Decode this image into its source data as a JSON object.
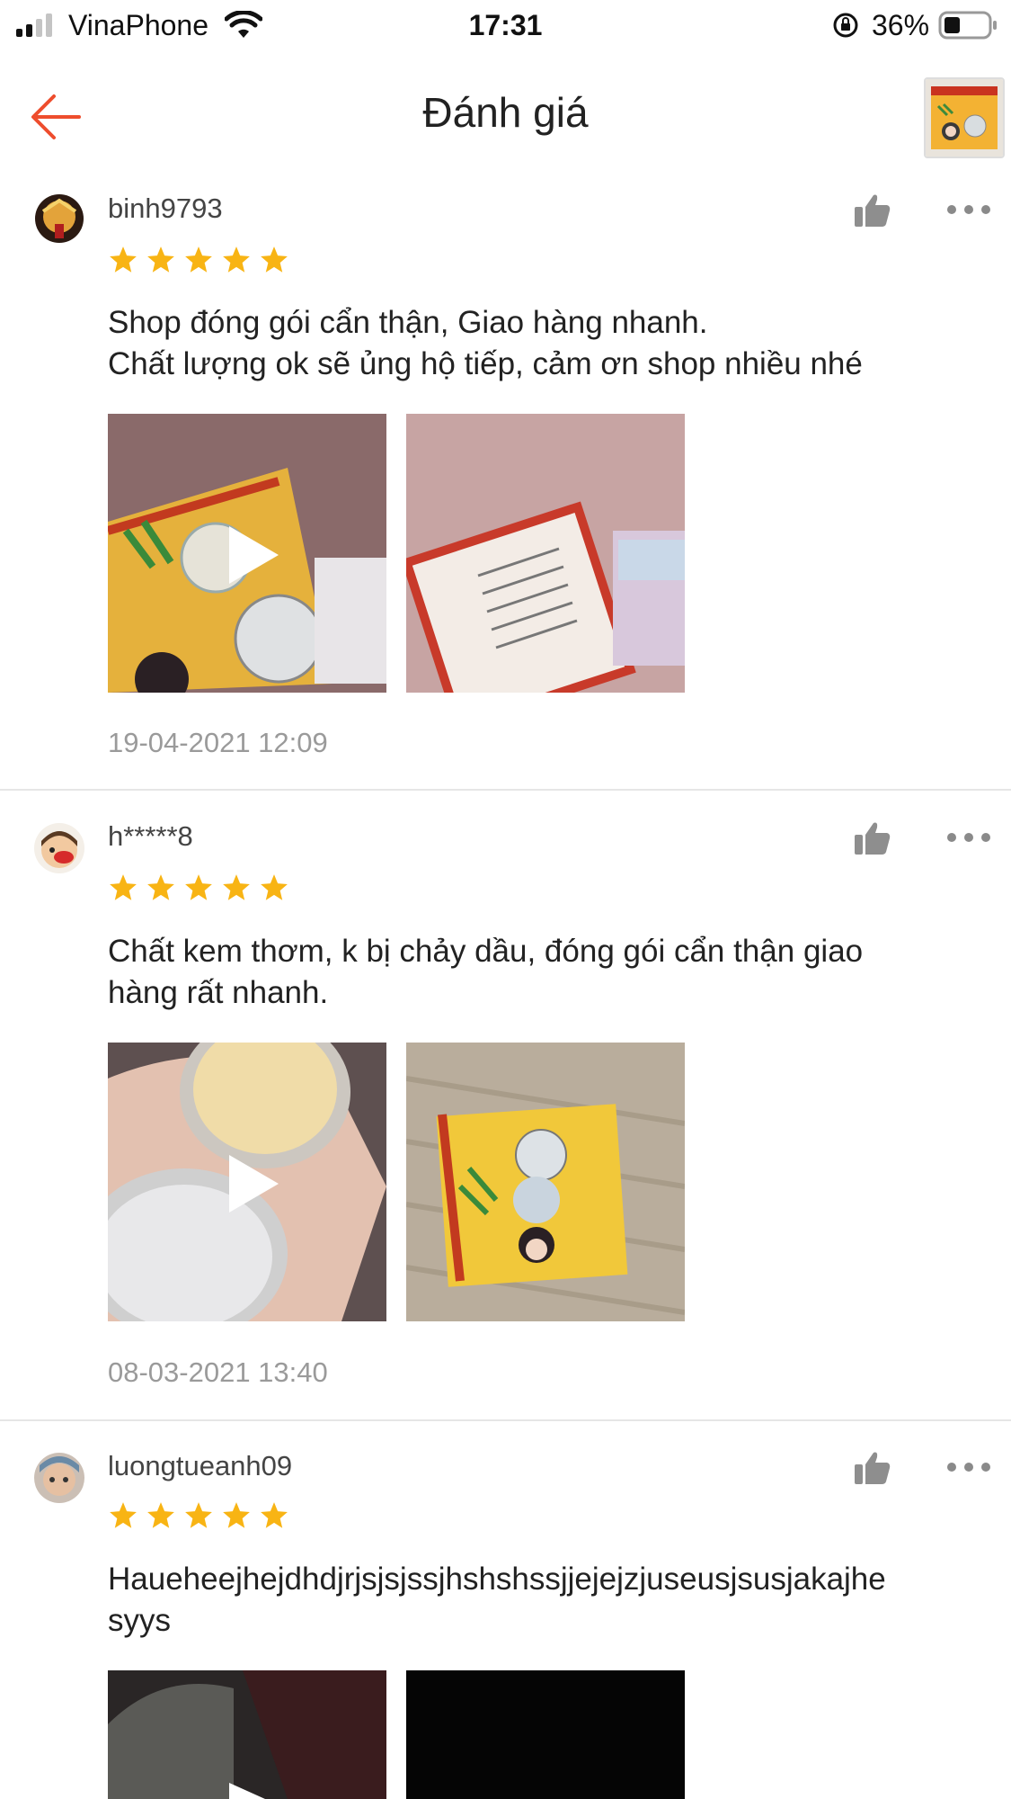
{
  "status_bar": {
    "carrier": "VinaPhone",
    "time": "17:31",
    "battery": "36%"
  },
  "header": {
    "title": "Đánh giá",
    "back_icon": "arrow-left-icon",
    "accent_color": "#ee4d2d"
  },
  "reviews": [
    {
      "username": "binh9793",
      "rating": 5,
      "text_lines": [
        "Shop đóng gói cẩn thận, Giao hàng nhanh.",
        "Chất lượng ok sẽ ủng hộ tiếp, cảm ơn shop nhiều nhé"
      ],
      "date": "19-04-2021 12:09",
      "media": [
        {
          "type": "video"
        },
        {
          "type": "image"
        }
      ]
    },
    {
      "username": "h*****8",
      "rating": 5,
      "text_lines": [
        "Chất kem thơm, k bị chảy dầu, đóng gói cẩn thận giao",
        "hàng rất nhanh."
      ],
      "date": "08-03-2021 13:40",
      "media": [
        {
          "type": "video"
        },
        {
          "type": "image"
        }
      ]
    },
    {
      "username": "luongtueanh09",
      "rating": 5,
      "text_lines": [
        "Haueheejhejdhdjrjsjsjssjhshshssjjejejzjuseusjsusjakajhe",
        "syys"
      ],
      "date": "",
      "media": [
        {
          "type": "video"
        },
        {
          "type": "image"
        }
      ]
    }
  ],
  "star_color": "#f8b414"
}
